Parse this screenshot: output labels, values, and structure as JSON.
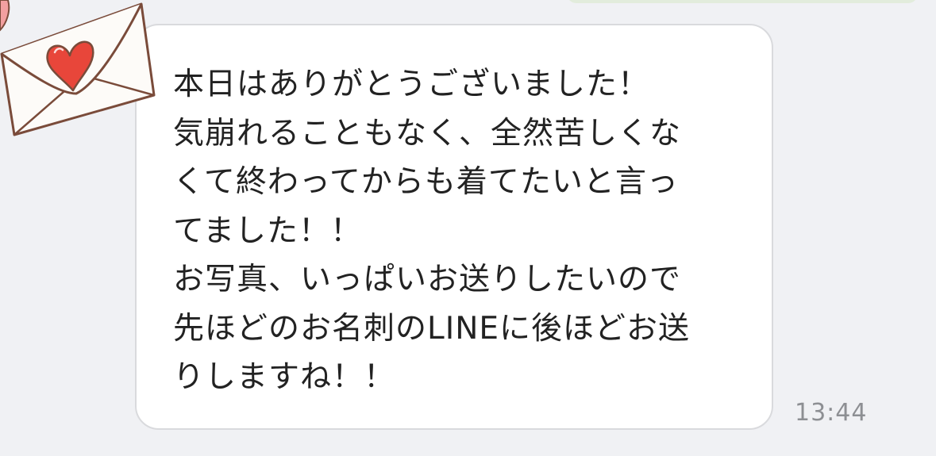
{
  "message": {
    "lines": [
      "本日はありがとうございました！",
      "気崩れることもなく、全然苦しくな",
      "くて終わってからも着てたいと言っ",
      "てました！！",
      "お写真、いっぱいお送りしたいので",
      "先ほどのお名刺のLINEに後ほどお送",
      "りしますね！！"
    ],
    "time": "13:44"
  },
  "sticker": {
    "icon": "envelope-heart-icon"
  },
  "colors": {
    "background": "#f0f1f4",
    "bubble": "#ffffff",
    "bubble_border": "#d9dadd",
    "text": "#222222",
    "timestamp": "#8d8f93",
    "heart": "#e8463a",
    "envelope_stroke": "#7a4b3a"
  }
}
